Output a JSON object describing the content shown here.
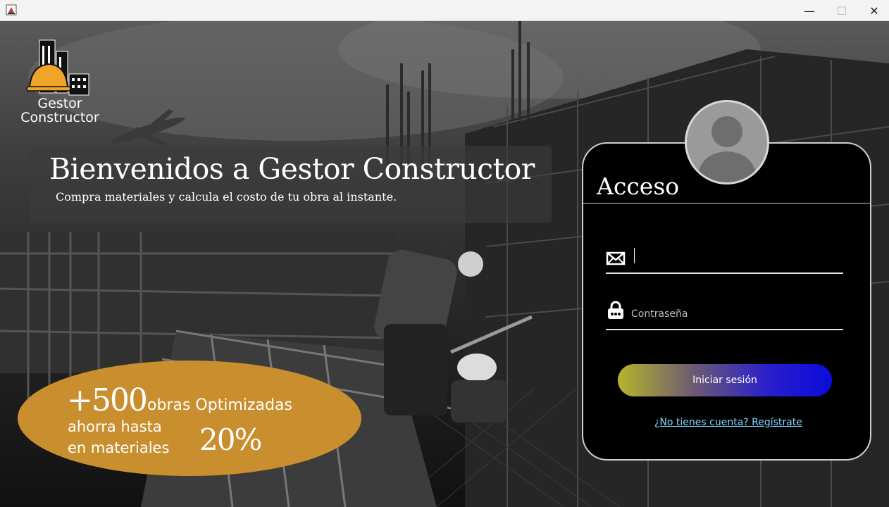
{
  "window": {
    "minimize_glyph": "—",
    "maximize_glyph": "☐",
    "close_glyph": "✕"
  },
  "logo": {
    "line1": "Gestor",
    "line2": "Constructor",
    "icon": "building-hardhat-icon",
    "helmet_color": "#f0a42a"
  },
  "welcome": {
    "title": "Bienvenidos a Gestor Constructor",
    "subtitle": "Compra materiales y calcula el costo de tu obra al instante."
  },
  "promo": {
    "big_number": "+500",
    "line1": "obras Optimizadas",
    "line2": "ahorra hasta",
    "line3": "en materiales",
    "percent": "20%",
    "color": "#c98f2f"
  },
  "login": {
    "title": "Acceso",
    "email_value": "",
    "email_icon": "envelope-icon",
    "password_placeholder": "Contraseña",
    "password_icon": "lock-icon",
    "submit_label": "Iniciar sesión",
    "register_link": "¿No tienes cuenta? Regístrate",
    "link_color": "#7fd8ff"
  }
}
